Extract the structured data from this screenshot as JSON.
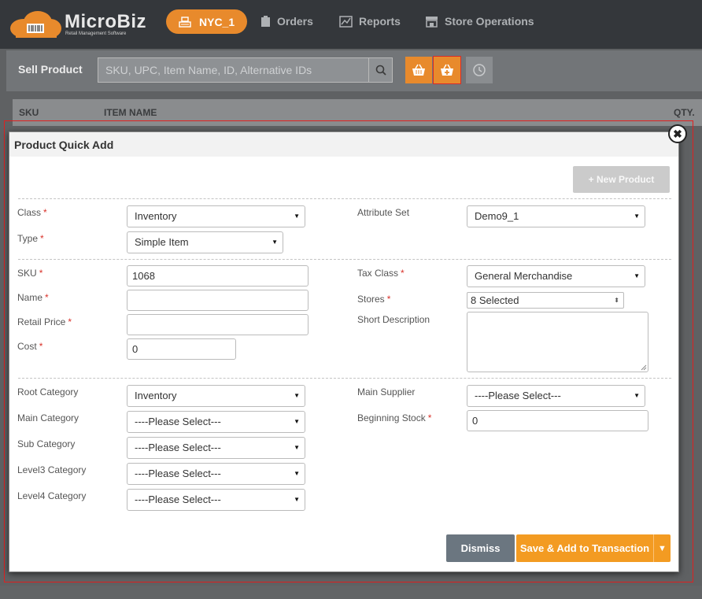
{
  "app": {
    "logo_title": "MicroBiz",
    "logo_subtitle": "Retail Management Software",
    "store": "NYC_1",
    "nav": [
      "Orders",
      "Reports",
      "Store Operations"
    ]
  },
  "sellbar": {
    "label": "Sell Product",
    "search_placeholder": "SKU, UPC, Item Name, ID, Alternative IDs"
  },
  "table": {
    "headers": [
      "SKU",
      "ITEM NAME",
      "QTY."
    ]
  },
  "modal": {
    "title": "Product Quick Add",
    "new_product": "+ New Product",
    "fields": {
      "class_label": "Class",
      "class_value": "Inventory",
      "type_label": "Type",
      "type_value": "Simple Item",
      "attribute_set_label": "Attribute Set",
      "attribute_set_value": "Demo9_1",
      "sku_label": "SKU",
      "sku_value": "1068",
      "name_label": "Name",
      "name_value": "",
      "retail_price_label": "Retail Price",
      "retail_price_value": "",
      "cost_label": "Cost",
      "cost_value": "0",
      "tax_class_label": "Tax Class",
      "tax_class_value": "General Merchandise",
      "stores_label": "Stores",
      "stores_value": "8 Selected",
      "short_description_label": "Short Description",
      "short_description_value": "",
      "root_category_label": "Root Category",
      "root_category_value": "Inventory",
      "main_category_label": "Main Category",
      "main_category_value": "----Please Select---",
      "sub_category_label": "Sub Category",
      "sub_category_value": "----Please Select---",
      "level3_category_label": "Level3 Category",
      "level3_category_value": "----Please Select---",
      "level4_category_label": "Level4 Category",
      "level4_category_value": "----Please Select---",
      "main_supplier_label": "Main Supplier",
      "main_supplier_value": "----Please Select---",
      "beginning_stock_label": "Beginning Stock",
      "beginning_stock_value": "0"
    },
    "required_mark": "*",
    "dismiss": "Dismiss",
    "save": "Save & Add to Transaction"
  },
  "colors": {
    "accent_orange": "#e88a2c",
    "save_orange": "#f39b22",
    "dismiss_grey": "#6b7680",
    "required_red": "#d9322a"
  }
}
